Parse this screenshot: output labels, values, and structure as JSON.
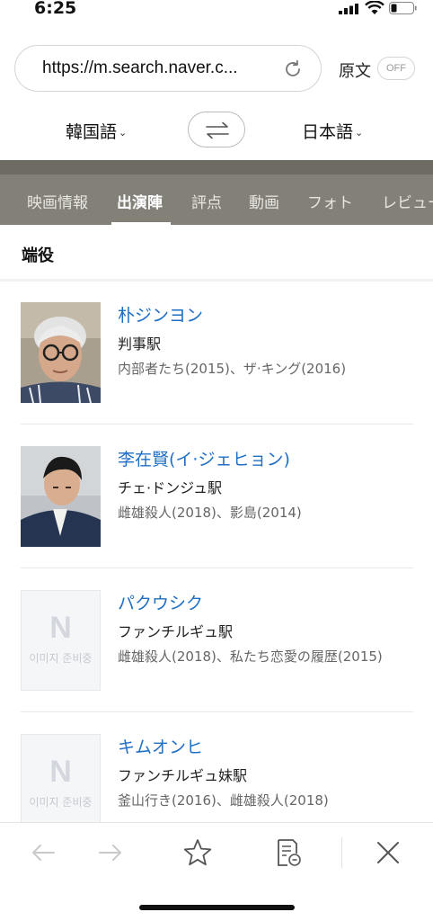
{
  "status": {
    "time": "6:25"
  },
  "browser": {
    "url": "https://m.search.naver.c...",
    "original_label": "原文",
    "toggle_label": "OFF"
  },
  "translate": {
    "source_lang": "韓国語",
    "target_lang": "日本語"
  },
  "tabs": [
    "映画情報",
    "出演陣",
    "評点",
    "動画",
    "フォト",
    "レビュー"
  ],
  "active_tab": "出演陣",
  "section_title": "端役",
  "placeholder_text": "이미지 준비중",
  "placeholder_logo": "N",
  "cast": [
    {
      "name": "朴ジンヨン",
      "role": "判事駅",
      "works": "内部者たち(2015)、ザ·キング(2016)",
      "photo": "photo"
    },
    {
      "name": "李在賢(イ·ジェヒョン)",
      "role": "チェ·ドンジュ駅",
      "works": "雌雄殺人(2018)、影島(2014)",
      "photo": "photo"
    },
    {
      "name": "パクウシク",
      "role": "ファンチルギュ駅",
      "works": "雌雄殺人(2018)、私たち恋愛の履歴(2015)",
      "photo": "placeholder"
    },
    {
      "name": "キムオンヒ",
      "role": "ファンチルギュ妹駅",
      "works": "釜山行き(2016)、雌雄殺人(2018)",
      "photo": "placeholder"
    }
  ],
  "colors": {
    "link": "#1f6fc5",
    "tab_bar": "#838078",
    "band": "#6e6b64"
  }
}
